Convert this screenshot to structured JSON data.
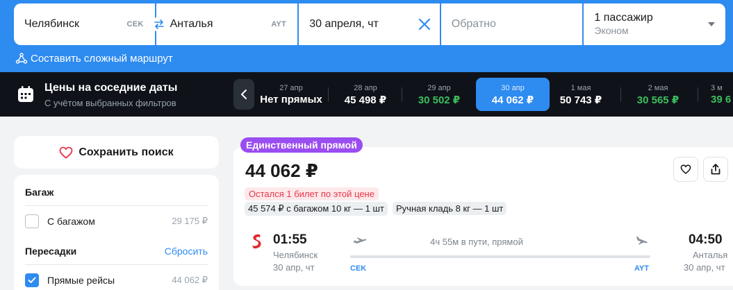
{
  "search": {
    "from": "Челябинск",
    "from_iata": "CEK",
    "to": "Анталья",
    "to_iata": "AYT",
    "date": "30 апреля, чт",
    "return_placeholder": "Обратно",
    "passengers": "1 пассажир",
    "cabin_class": "Эконом",
    "complex_route_link": "Составить сложный маршрут"
  },
  "date_strip": {
    "title": "Цены на соседние даты",
    "subtitle": "С учётом выбранных фильтров",
    "days": [
      {
        "date": "27 апр",
        "price": "Нет прямых",
        "color": "white"
      },
      {
        "date": "28 апр",
        "price": "45 498 ₽",
        "color": "white"
      },
      {
        "date": "29 апр",
        "price": "30 502 ₽",
        "color": "green"
      },
      {
        "date": "30 апр",
        "price": "44 062 ₽",
        "color": "white",
        "selected": true
      },
      {
        "date": "1 мая",
        "price": "50 743 ₽",
        "color": "white"
      },
      {
        "date": "2 мая",
        "price": "30 565 ₽",
        "color": "green"
      },
      {
        "date": "3 м",
        "price": "39 6",
        "color": "green"
      }
    ]
  },
  "sidebar": {
    "save_search": "Сохранить поиск",
    "baggage": {
      "heading": "Багаж",
      "option_label": "С багажом",
      "option_price": "29 175 ₽",
      "checked": false
    },
    "transfers": {
      "heading": "Пересадки",
      "reset": "Сбросить",
      "option_label": "Прямые рейсы",
      "option_price": "44 062 ₽",
      "checked": true
    }
  },
  "ticket": {
    "badge": "Единственный прямой",
    "price": "44 062 ₽",
    "warning": "Остался 1 билет по этой цене",
    "chips": [
      "45 574 ₽ с багажом 10 кг — 1 шт",
      "Ручная кладь 8 кг — 1 шт"
    ],
    "departure": {
      "time": "01:55",
      "city": "Челябинск",
      "date": "30 апр, чт",
      "iata": "CEK"
    },
    "arrival": {
      "time": "04:50",
      "city": "Анталья",
      "date": "30 апр, чт",
      "iata": "AYT"
    },
    "duration": "4ч 55м в пути, прямой"
  },
  "colors": {
    "brand_blue": "#2e8bf0",
    "dark_bar": "#0f1319",
    "cheap_green": "#3cbf5c",
    "badge_purple": "#9a4df0",
    "warning_red": "#e8364a"
  }
}
